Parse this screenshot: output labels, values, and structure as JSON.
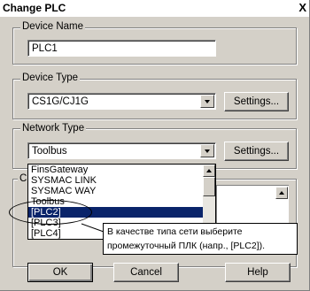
{
  "window": {
    "title": "Change PLC",
    "close_glyph": "X"
  },
  "device_name": {
    "label": "Device Name",
    "value": "PLC1"
  },
  "device_type": {
    "label": "Device Type",
    "value": "CS1G/CJ1G",
    "settings_label": "Settings..."
  },
  "network_type": {
    "label": "Network Type",
    "value": "Toolbus",
    "settings_label": "Settings...",
    "dropdown_items": [
      "FinsGateway",
      "SYSMAC LINK",
      "SYSMAC WAY",
      "Toolbus",
      "[PLC2]",
      "[PLC3]",
      "[PLC4]"
    ],
    "selected_item": "[PLC2]"
  },
  "hidden_group_label": "C",
  "callout": {
    "line1": "В качестве типа сети выберите",
    "line2": "промежуточный ПЛК (напр., [PLC2])."
  },
  "buttons": {
    "ok": "OK",
    "cancel": "Cancel",
    "help": "Help"
  }
}
